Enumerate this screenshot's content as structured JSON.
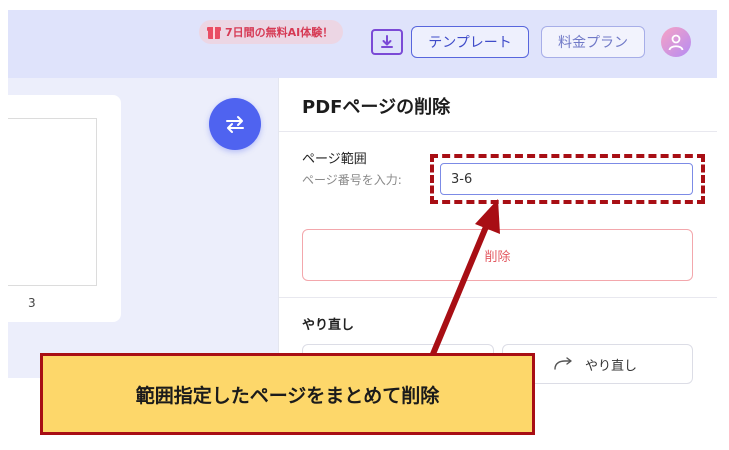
{
  "header": {
    "promo_text": "7日間の無料AI体験！",
    "template_label": "テンプレート",
    "plan_label": "料金プラン",
    "icons": [
      "gift-icon",
      "download-icon",
      "avatar-icon"
    ]
  },
  "preview": {
    "page_number": "3",
    "swap_icon": "swap-arrows-icon"
  },
  "panel": {
    "title": "PDFページの削除",
    "range_label": "ページ範囲",
    "range_hint": "ページ番号を入力:",
    "range_value": "3-6",
    "delete_label": "削除",
    "redo_section_label": "やり直し",
    "redo_button_label": "やり直し",
    "redo_icon": "redo-arrow-icon"
  },
  "annotation": {
    "callout_text": "範囲指定したページをまとめて削除"
  },
  "colors": {
    "accent": "#4f63f0",
    "highlight": "#a80e14",
    "callout_bg": "#fdd76a",
    "delete_text": "#e35a62"
  }
}
